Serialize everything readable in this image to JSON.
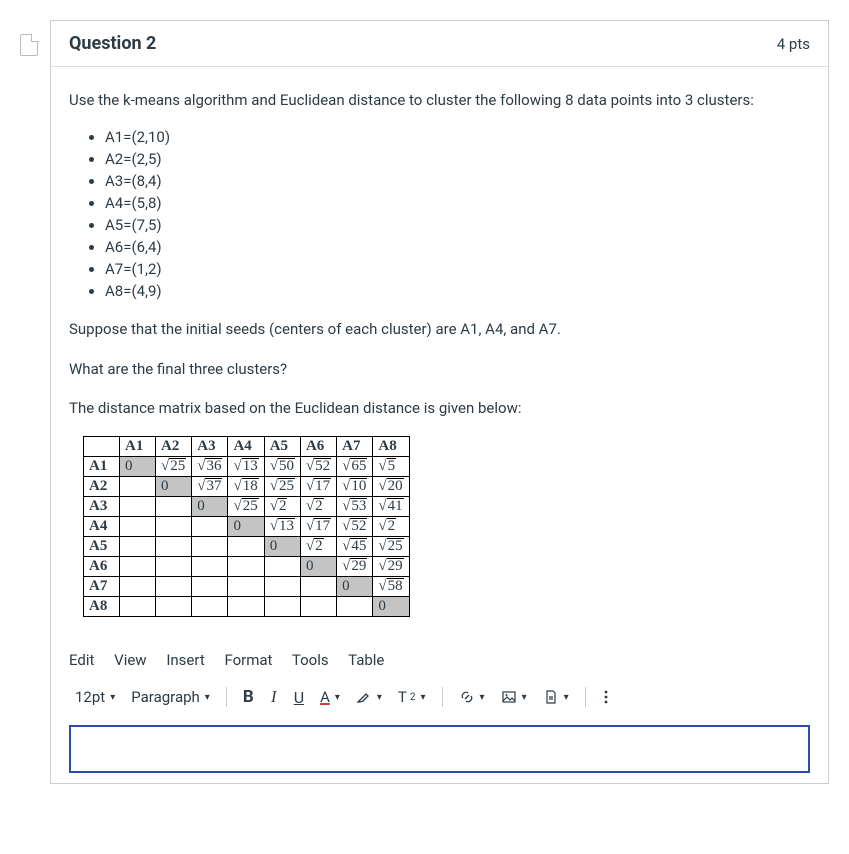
{
  "header": {
    "title": "Question 2",
    "points": "4 pts"
  },
  "question": {
    "intro": "Use the k-means algorithm and Euclidean distance to cluster the following 8 data points into 3 clusters:",
    "dataPoints": [
      "A1=(2,10)",
      "A2=(2,5)",
      "A3=(8,4)",
      "A4=(5,8)",
      "A5=(7,5)",
      "A6=(6,4)",
      "A7=(1,2)",
      "A8=(4,9)"
    ],
    "seeds": "Suppose that the initial seeds (centers of each cluster) are A1, A4, and A7.",
    "ask": "What are the final three clusters?",
    "matrixIntro": "The distance matrix based on the Euclidean distance is given below:"
  },
  "matrix": {
    "headers": [
      "",
      "A1",
      "A2",
      "A3",
      "A4",
      "A5",
      "A6",
      "A7",
      "A8"
    ],
    "rows": [
      {
        "label": "A1",
        "cells": [
          {
            "v": "0",
            "shaded": true
          },
          {
            "sqrt": "25"
          },
          {
            "sqrt": "36"
          },
          {
            "sqrt": "13"
          },
          {
            "sqrt": "50"
          },
          {
            "sqrt": "52"
          },
          {
            "sqrt": "65"
          },
          {
            "sqrt": "5"
          }
        ]
      },
      {
        "label": "A2",
        "cells": [
          {
            "v": ""
          },
          {
            "v": "0",
            "shaded": true
          },
          {
            "sqrt": "37"
          },
          {
            "sqrt": "18"
          },
          {
            "sqrt": "25"
          },
          {
            "sqrt": "17"
          },
          {
            "sqrt": "10"
          },
          {
            "sqrt": "20"
          }
        ]
      },
      {
        "label": "A3",
        "cells": [
          {
            "v": ""
          },
          {
            "v": ""
          },
          {
            "v": "0",
            "shaded": true
          },
          {
            "sqrt": "25"
          },
          {
            "sqrt": "2"
          },
          {
            "sqrt": "2"
          },
          {
            "sqrt": "53"
          },
          {
            "sqrt": "41"
          }
        ]
      },
      {
        "label": "A4",
        "cells": [
          {
            "v": ""
          },
          {
            "v": ""
          },
          {
            "v": ""
          },
          {
            "v": "0",
            "shaded": true
          },
          {
            "sqrt": "13"
          },
          {
            "sqrt": "17"
          },
          {
            "sqrt": "52"
          },
          {
            "sqrt": "2"
          }
        ]
      },
      {
        "label": "A5",
        "cells": [
          {
            "v": ""
          },
          {
            "v": ""
          },
          {
            "v": ""
          },
          {
            "v": ""
          },
          {
            "v": "0",
            "shaded": true
          },
          {
            "sqrt": "2"
          },
          {
            "sqrt": "45"
          },
          {
            "sqrt": "25"
          }
        ]
      },
      {
        "label": "A6",
        "cells": [
          {
            "v": ""
          },
          {
            "v": ""
          },
          {
            "v": ""
          },
          {
            "v": ""
          },
          {
            "v": ""
          },
          {
            "v": "0",
            "shaded": true
          },
          {
            "sqrt": "29"
          },
          {
            "sqrt": "29"
          }
        ]
      },
      {
        "label": "A7",
        "cells": [
          {
            "v": ""
          },
          {
            "v": ""
          },
          {
            "v": ""
          },
          {
            "v": ""
          },
          {
            "v": ""
          },
          {
            "v": ""
          },
          {
            "v": "0",
            "shaded": true
          },
          {
            "sqrt": "58"
          }
        ]
      },
      {
        "label": "A8",
        "cells": [
          {
            "v": ""
          },
          {
            "v": ""
          },
          {
            "v": ""
          },
          {
            "v": ""
          },
          {
            "v": ""
          },
          {
            "v": ""
          },
          {
            "v": ""
          },
          {
            "v": "0",
            "shaded": true
          }
        ]
      }
    ]
  },
  "editor": {
    "menus": [
      "Edit",
      "View",
      "Insert",
      "Format",
      "Tools",
      "Table"
    ],
    "fontSize": "12pt",
    "blockType": "Paragraph"
  }
}
